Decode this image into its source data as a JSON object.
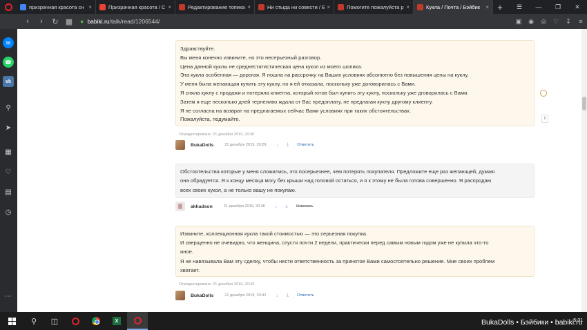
{
  "browser": {
    "tabs": [
      {
        "title": "призрачная красота сн",
        "icon_color": "#4285f4",
        "active": false
      },
      {
        "title": "Призрачная красота / С",
        "icon_color": "#ea4335",
        "active": false
      },
      {
        "title": "Редактирование топика",
        "icon_color": "#c0392b",
        "active": false
      },
      {
        "title": "Ни стыда ни совести / Б",
        "icon_color": "#c0392b",
        "active": false
      },
      {
        "title": "Помогите пожалуйста р",
        "icon_color": "#c0392b",
        "active": false
      },
      {
        "title": "Кукла / Почта / Бэйбик",
        "icon_color": "#c0392b",
        "active": true
      }
    ],
    "new_tab": "+",
    "url_domain": "babiki.ru",
    "url_path": "/talk/read/1206544/"
  },
  "comments": [
    {
      "lines": [
        "Здравствуйте.",
        "Вы меня конечно извините, но это несерьезный разговор.",
        "Цена данной куклы не среднестатистическая цена кукол из моего шопика.",
        "Эта кукла особенная — дорогая. Я пошла на рассрочку на Ваших условиях абсолютно без повышения цены на куклу.",
        "У меня была желающая купить эту куклу, но я ей отказала, поскольку уже договорилась с Вами.",
        "Я сняла куклу с продажи и потеряла клиента, который готов был купить эту куклу, поскольку уже дговорилась с Вами.",
        "Затем я еще несколько дней терпеливо ждала от Вас предоплату, не предлагая куклу другому клиенту.",
        "Я не согласна на возврат на предлагаемых сейчас Вами условиях при таких обстоятельствах.",
        "Пожалуйста, подумайте."
      ],
      "edited": "Отредактировано: 21 декабря 2019, 20:36",
      "author": "BukaDolls",
      "date": "21 декабря 2019, 20:29",
      "reply": "Ответить"
    },
    {
      "lines": [
        "Обстоятельства которые у меня сложились, это посерьезнее, чем потерять покупателя. Предложите еще раз желающей, думаю",
        "она обрадуется. Я к концу месяца могу без крыши над головой остаться, и я к этому не была готова совершенно. Я распродаю",
        "всех своих кукол, а не только вашу не покупаю."
      ],
      "author": "akhadson",
      "date": "21 декабря 2019, 20:36",
      "reply": "Ответить"
    },
    {
      "lines": [
        "Извините, коллекционная кукла такой стоимостью — это серьезная покупка.",
        "И сверщенно не очевидно, что женщина, спустя почти 2 недели, практически перед самым новым годом уже не купила что-то",
        "иное.",
        "Я не навязывала Вам эту сделку, чтобы нести ответственность за принятое Вами самостоятельно решение. Мне своих проблем",
        "хватает."
      ],
      "edited": "Отредактировано: 21 декабря 2019, 20:43",
      "author": "BukaDolls",
      "date": "21 декабря 2019, 20:42",
      "reply": "Ответить"
    }
  ],
  "taskbar": {
    "time": "5:31",
    "watermark": "BukaDolls • Бэйбики • babiki.ru"
  }
}
